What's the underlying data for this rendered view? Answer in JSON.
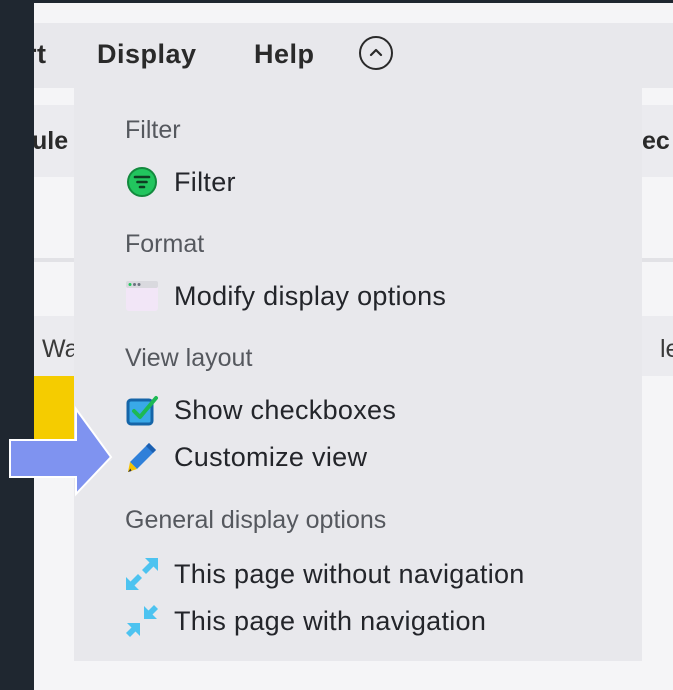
{
  "menubar": {
    "partial_left": "rt",
    "display": "Display",
    "help": "Help"
  },
  "background": {
    "left_header_fragment": "ule",
    "right_header_fragment": "ec",
    "left_cell_fragment": "Wa",
    "right_cell_fragment": "le"
  },
  "dropdown": {
    "sections": [
      {
        "title": "Filter",
        "items": [
          {
            "label": "Filter",
            "icon": "filter-icon"
          }
        ]
      },
      {
        "title": "Format",
        "items": [
          {
            "label": "Modify display options",
            "icon": "window-icon"
          }
        ]
      },
      {
        "title": "View layout",
        "items": [
          {
            "label": "Show checkboxes",
            "icon": "checkbox-icon"
          },
          {
            "label": "Customize view",
            "icon": "pencil-icon"
          }
        ]
      },
      {
        "title": "General display options",
        "items": [
          {
            "label": "This page without navigation",
            "icon": "expand-icon"
          },
          {
            "label": "This page with navigation",
            "icon": "collapse-icon"
          }
        ]
      }
    ]
  },
  "colors": {
    "accent_arrow": "#7f93f0",
    "filter_green": "#22c55e",
    "checkbox_blue": "#1f8fd6",
    "yellow_cell": "#f5cc00"
  }
}
